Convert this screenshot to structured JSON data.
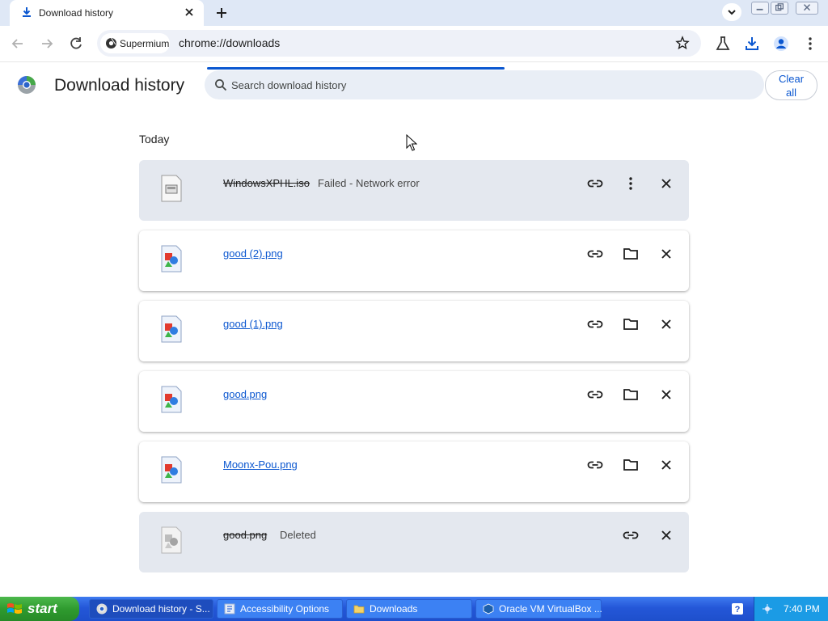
{
  "window": {
    "tab_title": "Download history",
    "url": "chrome://downloads",
    "profile_chip": "Supermium"
  },
  "page": {
    "title": "Download history",
    "search_placeholder": "Search download history",
    "clear_all_line1": "Clear",
    "clear_all_line2": "all",
    "section_date": "Today"
  },
  "downloads": [
    {
      "name": "WindowsXPHL.iso",
      "status": "Failed - Network error",
      "state": "failed",
      "icon": "iso-file-icon",
      "actions": [
        "copy-link",
        "more",
        "remove"
      ]
    },
    {
      "name": "good (2).png",
      "status": "",
      "state": "complete",
      "icon": "png-file-icon",
      "actions": [
        "copy-link",
        "show-in-folder",
        "remove"
      ]
    },
    {
      "name": "good (1).png",
      "status": "",
      "state": "complete",
      "icon": "png-file-icon",
      "actions": [
        "copy-link",
        "show-in-folder",
        "remove"
      ]
    },
    {
      "name": "good.png",
      "status": "",
      "state": "complete",
      "icon": "png-file-icon",
      "actions": [
        "copy-link",
        "show-in-folder",
        "remove"
      ]
    },
    {
      "name": "Moonx-Pou.png",
      "status": "",
      "state": "complete",
      "icon": "png-file-icon",
      "actions": [
        "copy-link",
        "show-in-folder",
        "remove"
      ]
    },
    {
      "name": "good.png",
      "status": "Deleted",
      "state": "deleted",
      "icon": "png-file-icon",
      "actions": [
        "copy-link",
        "remove"
      ]
    }
  ],
  "taskbar": {
    "start_label": "start",
    "tasks": [
      {
        "label": "Download history - S...",
        "icon": "chrome-icon"
      },
      {
        "label": "Accessibility Options",
        "icon": "accessibility-icon"
      },
      {
        "label": "Downloads",
        "icon": "folder-icon"
      },
      {
        "label": "Oracle VM VirtualBox ...",
        "icon": "virtualbox-icon"
      }
    ],
    "clock": "7:40 PM"
  },
  "colors": {
    "accent": "#0b57d0",
    "dim_card": "#e4e8ef",
    "tabstrip": "#dfe8f6",
    "taskbar": "#2457d8",
    "start": "#2f9b2f"
  }
}
